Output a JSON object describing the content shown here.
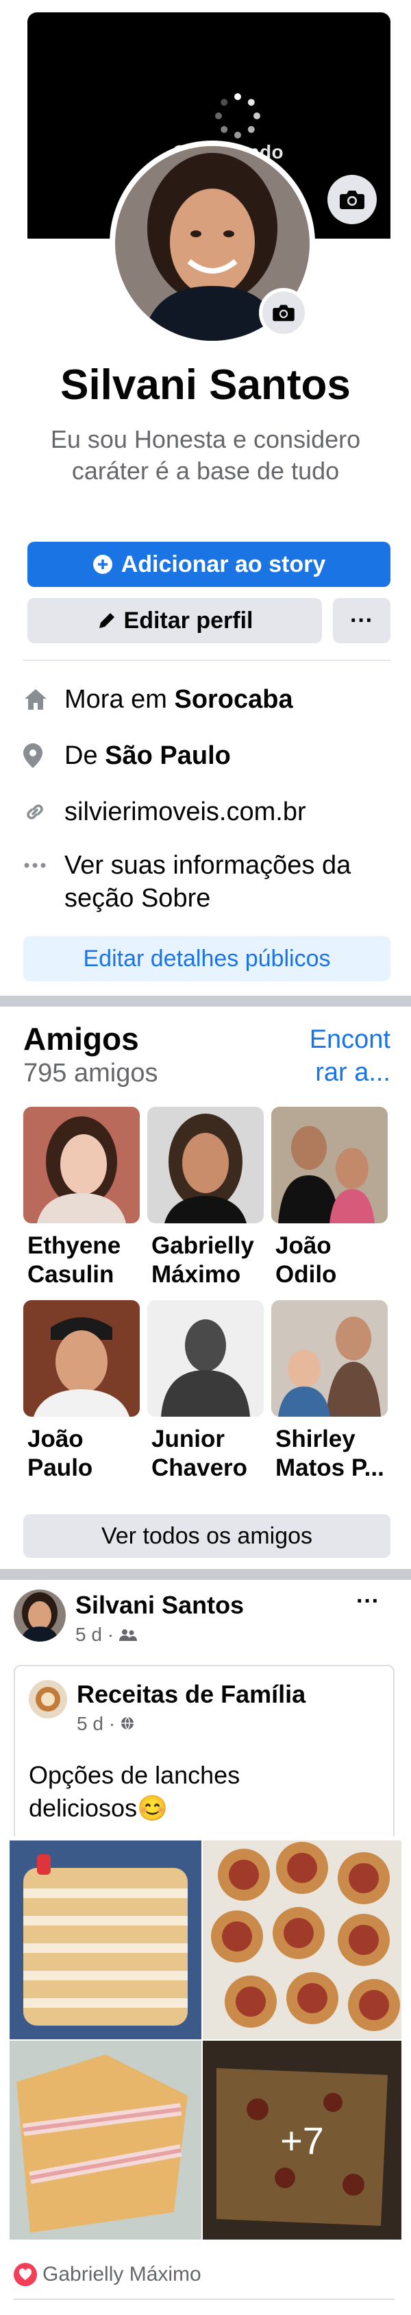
{
  "cover": {
    "loading_text": "Carregando",
    "camera_icon": "camera-icon"
  },
  "profile": {
    "name": "Silvani Santos",
    "bio": "Eu sou Honesta e considero caráter  é a base de tudo",
    "add_story_label": "Adicionar ao story",
    "edit_profile_label": "Editar perfil",
    "more_label": "···"
  },
  "intro": {
    "lives_prefix": "Mora em ",
    "lives_city": "Sorocaba",
    "from_prefix": "De ",
    "from_city": "São Paulo",
    "website": "silvierimoveis.com.br",
    "about": "Ver suas informações da seção Sobre",
    "edit_public_label": "Editar detalhes públicos"
  },
  "friends": {
    "title": "Amigos",
    "count": "795 amigos",
    "find_link": "Encontrar a...",
    "find_link_line1": "Encont",
    "find_link_line2": "rar a...",
    "items": [
      {
        "name_line1": "Ethyene",
        "name_line2": "Casulin"
      },
      {
        "name_line1": "Gabrielly",
        "name_line2": "Máximo"
      },
      {
        "name_line1": "João",
        "name_line2": "Odilo"
      },
      {
        "name_line1": "João",
        "name_line2": "Paulo"
      },
      {
        "name_line1": "Junior",
        "name_line2": "Chavero"
      },
      {
        "name_line1": "Shirley",
        "name_line2": "Matos P..."
      }
    ],
    "see_all_label": "Ver todos os amigos"
  },
  "post": {
    "author": "Silvani Santos",
    "time": "5 d · ",
    "more_label": "···",
    "shared": {
      "author": "Receitas de Família",
      "time": "5 d · ",
      "text": "Opções de lanches deliciosos😊"
    },
    "more_photos": "+7",
    "reaction_by": "Gabrielly Máximo"
  },
  "colors": {
    "accent": "#1b74e4",
    "secondary_text": "#65676b",
    "button_gray": "#e4e6eb",
    "heart": "#f33e58"
  }
}
